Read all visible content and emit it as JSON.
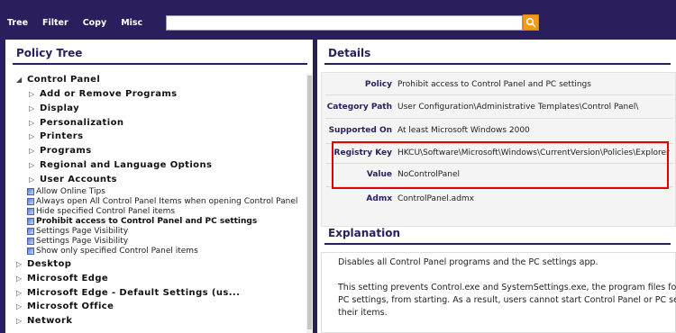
{
  "menu": [
    "Tree",
    "Filter",
    "Copy",
    "Misc"
  ],
  "search": {
    "value": "",
    "placeholder": ""
  },
  "policy_tree": {
    "title": "Policy Tree",
    "root": "Control Panel",
    "sub": [
      "Add or Remove Programs",
      "Display",
      "Personalization",
      "Printers",
      "Programs",
      "Regional and Language Options",
      "User Accounts"
    ],
    "leaves": [
      "Allow Online Tips",
      "Always open All Control Panel Items when opening Control Panel",
      "Hide specified Control Panel items",
      "Prohibit access to Control Panel and PC settings",
      "Settings Page Visibility",
      "Settings Page Visibility",
      "Show only specified Control Panel items"
    ],
    "other": [
      "Desktop",
      "Microsoft Edge",
      "Microsoft Edge - Default Settings (us...",
      "Microsoft Office",
      "Network"
    ]
  },
  "details": {
    "title": "Details",
    "rows": [
      {
        "k": "Policy",
        "v": "Prohibit access to Control Panel and PC settings"
      },
      {
        "k": "Category Path",
        "v": "User Configuration\\Administrative Templates\\Control Panel\\"
      },
      {
        "k": "Supported On",
        "v": "At least Microsoft Windows 2000"
      },
      {
        "k": "Registry Key",
        "v": "HKCU\\Software\\Microsoft\\Windows\\CurrentVersion\\Policies\\Explorer"
      },
      {
        "k": "Value",
        "v": "NoControlPanel"
      },
      {
        "k": "Admx",
        "v": "ControlPanel.admx"
      }
    ]
  },
  "explanation": {
    "title": "Explanation",
    "lines": [
      "Disables all Control Panel programs and the PC settings app.",
      "This setting prevents Control.exe and SystemSettings.exe, the program files for",
      "PC settings, from starting. As a result, users cannot start Control Panel or PC set",
      "their items."
    ]
  },
  "colors": {
    "brand": "#2a1f5c",
    "accent": "#f39c12",
    "highlight": "#e00000"
  }
}
